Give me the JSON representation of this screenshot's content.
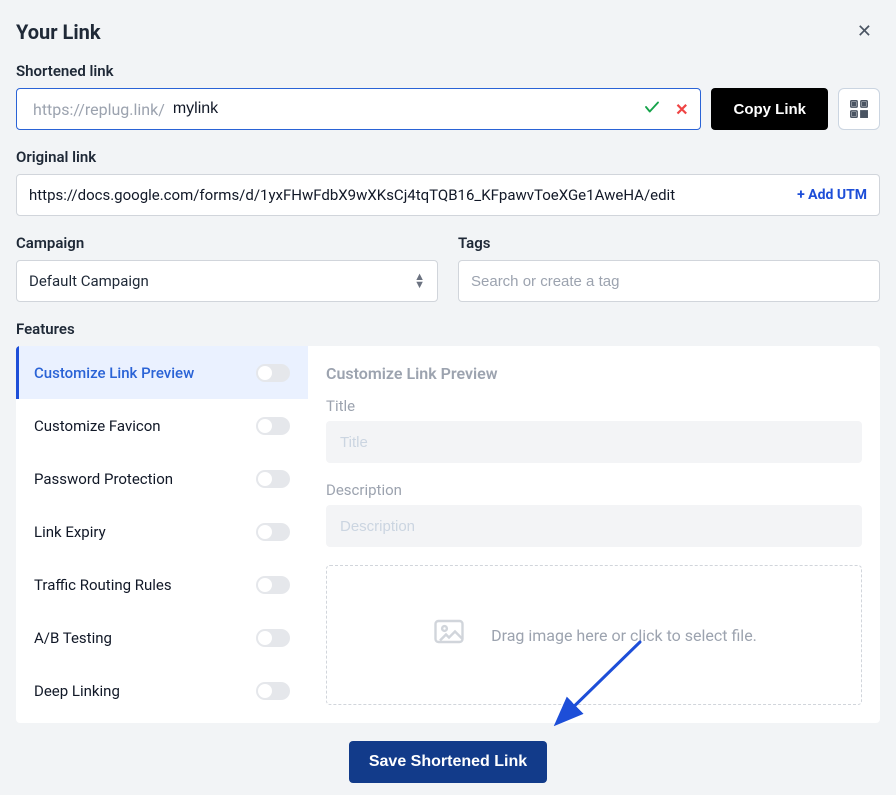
{
  "modal": {
    "title": "Your Link"
  },
  "shortened": {
    "label": "Shortened link",
    "prefix": "https://replug.link/",
    "value": "mylink",
    "copy_label": "Copy Link"
  },
  "original": {
    "label": "Original link",
    "url": "https://docs.google.com/forms/d/1yxFHwFdbX9wXKsCj4tqTQB16_KFpawvToeXGe1AweHA/edit",
    "add_utm": "+ Add UTM"
  },
  "campaign": {
    "label": "Campaign",
    "selected": "Default Campaign"
  },
  "tags": {
    "label": "Tags",
    "placeholder": "Search or create a tag"
  },
  "features": {
    "label": "Features",
    "items": [
      {
        "label": "Customize Link Preview",
        "active": true
      },
      {
        "label": "Customize Favicon",
        "active": false
      },
      {
        "label": "Password Protection",
        "active": false
      },
      {
        "label": "Link Expiry",
        "active": false
      },
      {
        "label": "Traffic Routing Rules",
        "active": false
      },
      {
        "label": "A/B Testing",
        "active": false
      },
      {
        "label": "Deep Linking",
        "active": false
      }
    ]
  },
  "preview_panel": {
    "title": "Customize Link Preview",
    "title_field_label": "Title",
    "title_placeholder": "Title",
    "desc_field_label": "Description",
    "desc_placeholder": "Description",
    "dropzone_text": "Drag image here or click to select file."
  },
  "save_label": "Save Shortened Link"
}
